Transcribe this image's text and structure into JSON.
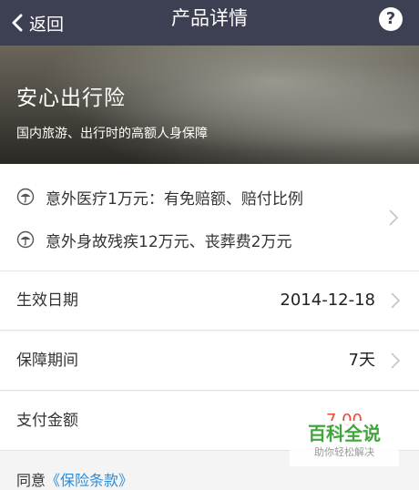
{
  "header": {
    "back_label": "返回",
    "title": "产品详情",
    "help_symbol": "?"
  },
  "hero": {
    "title": "安心出行险",
    "subtitle": "国内旅游、出行时的高额人身保障"
  },
  "coverage": {
    "items": [
      "意外医疗1万元：有免赔额、赔付比例",
      "意外身故残疾12万元、丧葬费2万元"
    ]
  },
  "rows": {
    "effective_date": {
      "label": "生效日期",
      "value": "2014-12-18"
    },
    "period": {
      "label": "保障期间",
      "value": "7天"
    },
    "payment": {
      "label": "支付金额",
      "value": "7.00"
    }
  },
  "agreement": {
    "prefix": "同意",
    "link": "《保险条款》"
  },
  "watermark": {
    "main": "百科全说",
    "sub": "助你轻松解决"
  },
  "colors": {
    "header_bg": "#3d3f52",
    "link": "#2e8bd6",
    "price": "#e84a3c",
    "watermark": "#3fa63a"
  }
}
